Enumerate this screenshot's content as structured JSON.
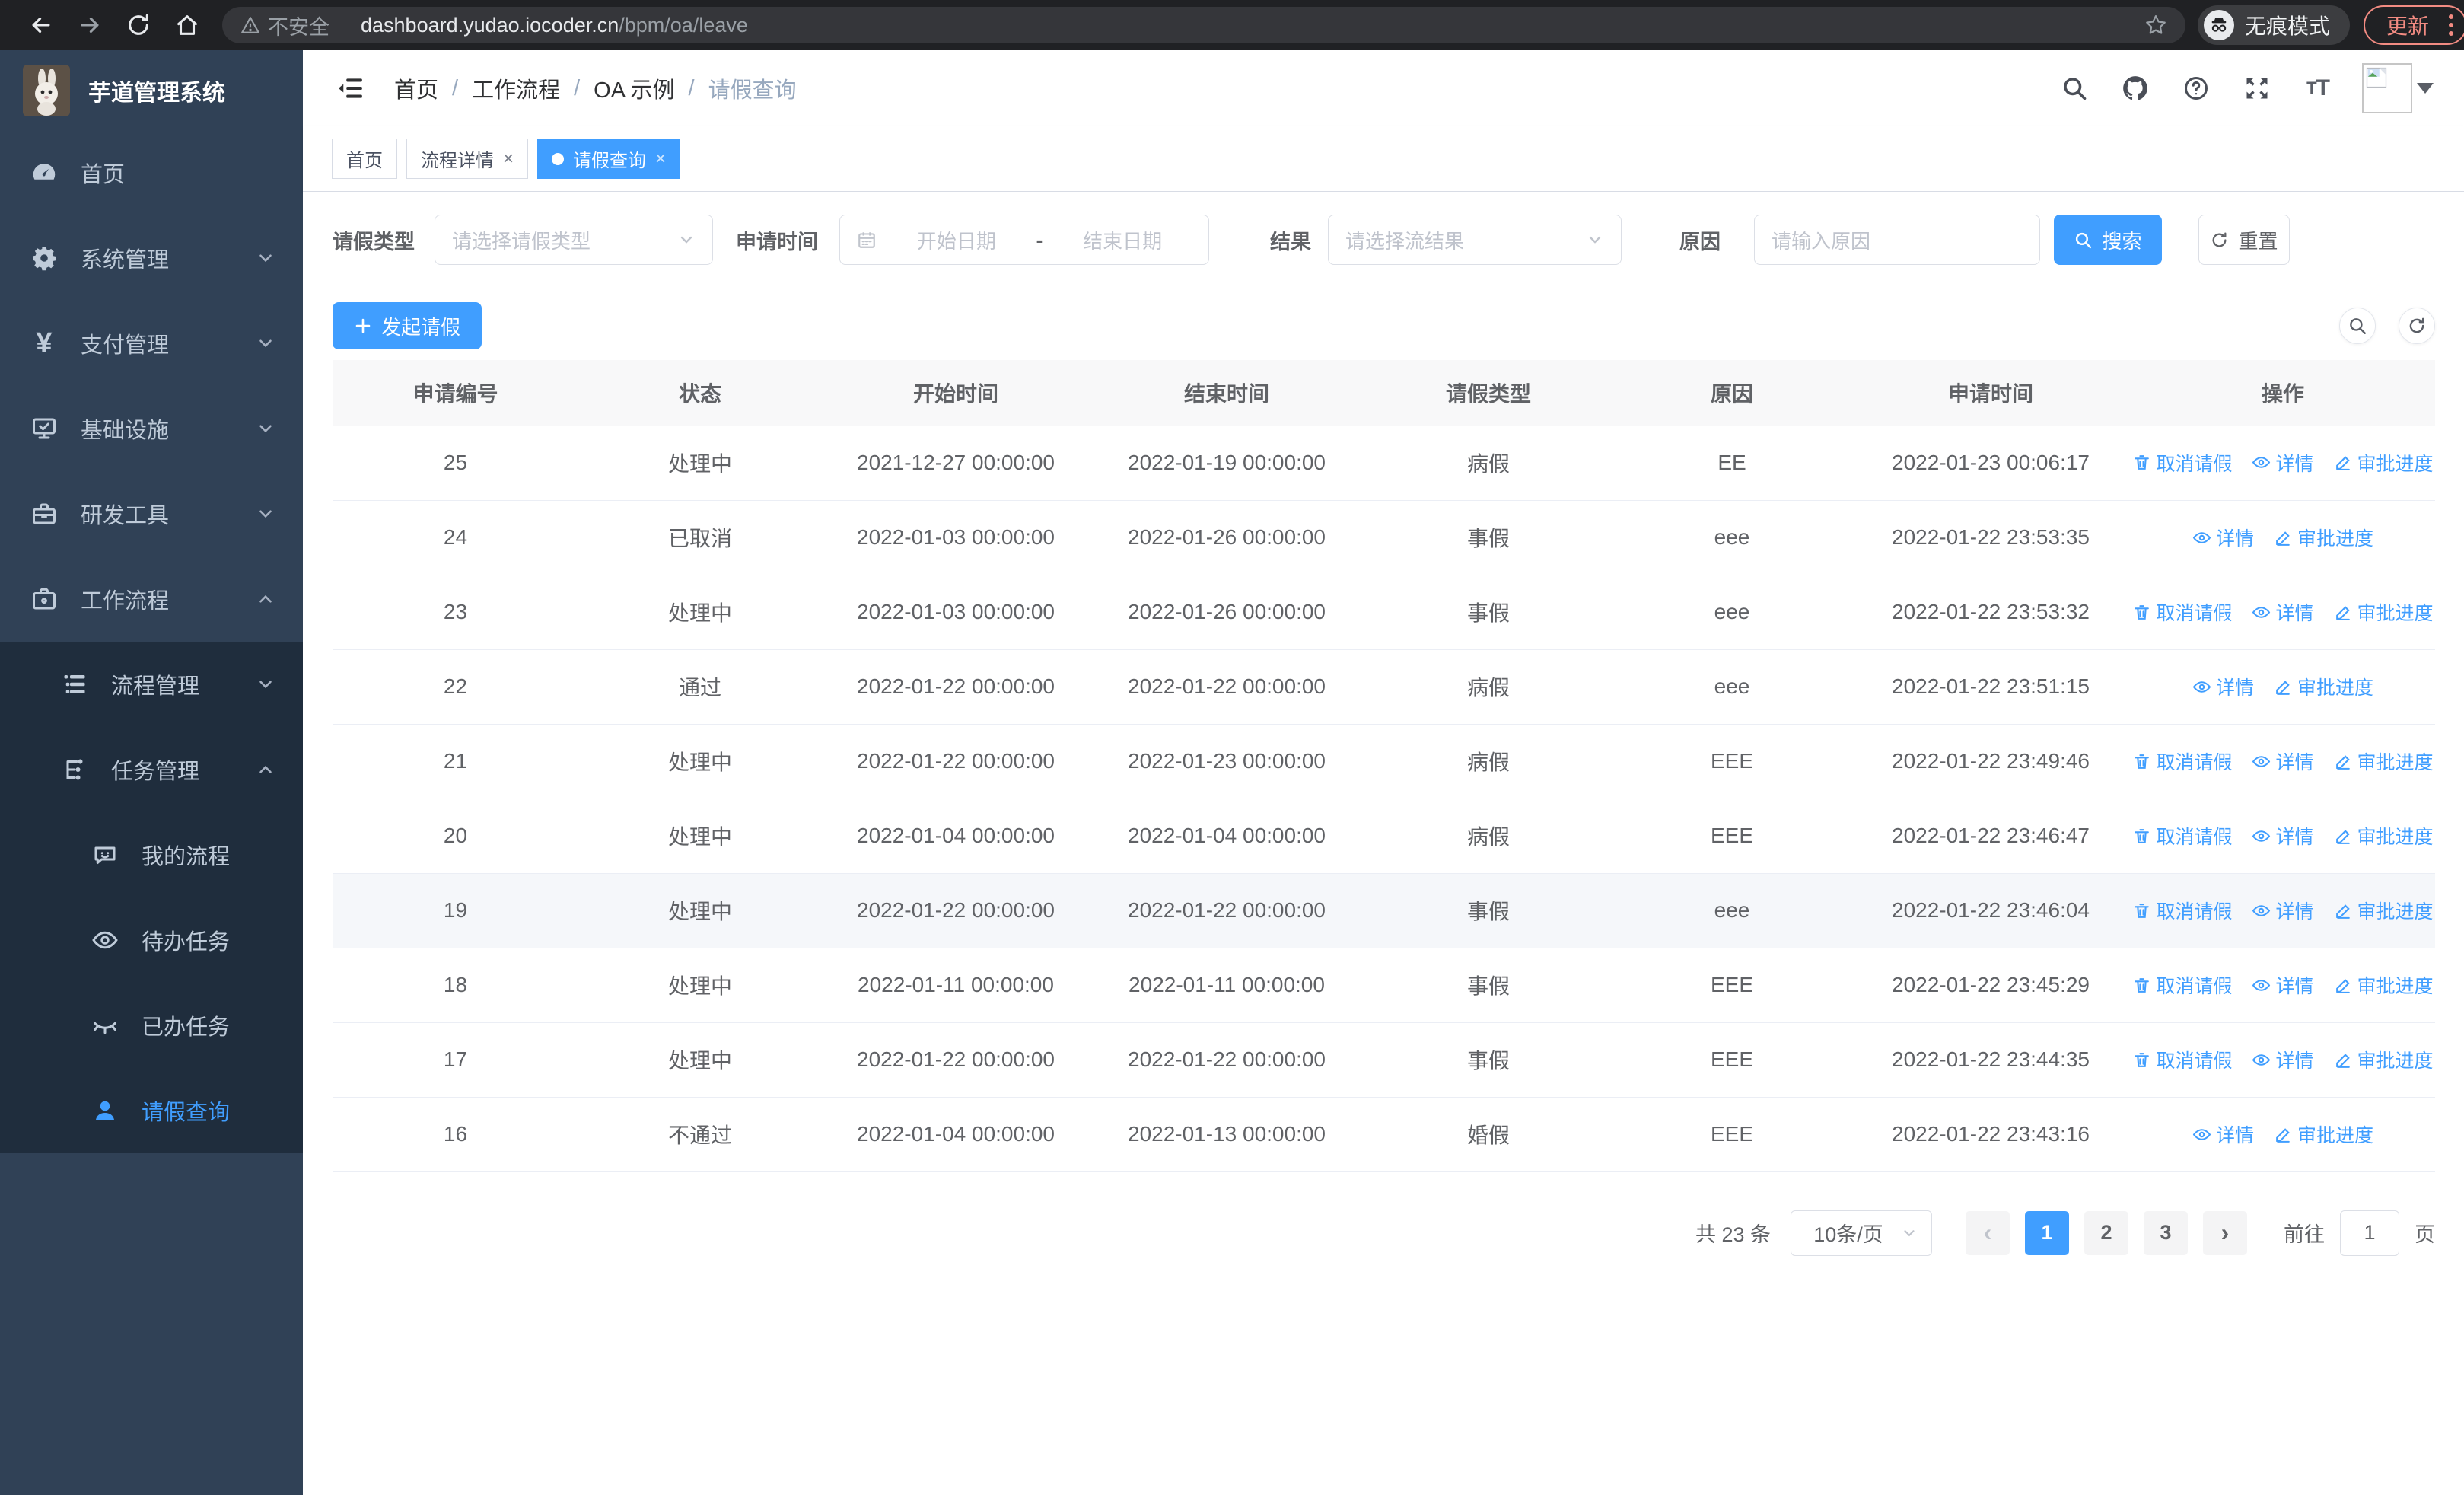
{
  "browser": {
    "security_warning": "不安全",
    "url_host": "dashboard.yudao.iocoder.cn",
    "url_path": "/bpm/oa/leave",
    "incognito_label": "无痕模式",
    "update_label": "更新"
  },
  "sidebar": {
    "app_title": "芋道管理系统",
    "items": [
      {
        "label": "首页"
      },
      {
        "label": "系统管理"
      },
      {
        "label": "支付管理"
      },
      {
        "label": "基础设施"
      },
      {
        "label": "研发工具"
      },
      {
        "label": "工作流程"
      }
    ],
    "submenu": [
      {
        "label": "流程管理"
      },
      {
        "label": "任务管理"
      },
      {
        "label": "我的流程"
      },
      {
        "label": "待办任务"
      },
      {
        "label": "已办任务"
      },
      {
        "label": "请假查询"
      }
    ]
  },
  "header": {
    "breadcrumb": [
      "首页",
      "工作流程",
      "OA 示例",
      "请假查询"
    ]
  },
  "tabs": [
    {
      "label": "首页"
    },
    {
      "label": "流程详情"
    },
    {
      "label": "请假查询"
    }
  ],
  "filters": {
    "type_label": "请假类型",
    "type_placeholder": "请选择请假类型",
    "time_label": "申请时间",
    "start_placeholder": "开始日期",
    "range_separator": "-",
    "end_placeholder": "结束日期",
    "result_label": "结果",
    "result_placeholder": "请选择流结果",
    "reason_label": "原因",
    "reason_placeholder": "请输入原因",
    "search_label": "搜索",
    "reset_label": "重置"
  },
  "toolbar": {
    "create_label": "发起请假"
  },
  "table": {
    "columns": [
      "申请编号",
      "状态",
      "开始时间",
      "结束时间",
      "请假类型",
      "原因",
      "申请时间",
      "操作"
    ],
    "action_labels": {
      "cancel": "取消请假",
      "detail": "详情",
      "progress": "审批进度"
    },
    "rows": [
      {
        "id": "25",
        "status": "处理中",
        "start": "2021-12-27 00:00:00",
        "end": "2022-01-19 00:00:00",
        "type": "病假",
        "reason": "EE",
        "applied": "2022-01-23 00:06:17",
        "cancelable": true,
        "highlighted": false
      },
      {
        "id": "24",
        "status": "已取消",
        "start": "2022-01-03 00:00:00",
        "end": "2022-01-26 00:00:00",
        "type": "事假",
        "reason": "eee",
        "applied": "2022-01-22 23:53:35",
        "cancelable": false,
        "highlighted": false
      },
      {
        "id": "23",
        "status": "处理中",
        "start": "2022-01-03 00:00:00",
        "end": "2022-01-26 00:00:00",
        "type": "事假",
        "reason": "eee",
        "applied": "2022-01-22 23:53:32",
        "cancelable": true,
        "highlighted": false
      },
      {
        "id": "22",
        "status": "通过",
        "start": "2022-01-22 00:00:00",
        "end": "2022-01-22 00:00:00",
        "type": "病假",
        "reason": "eee",
        "applied": "2022-01-22 23:51:15",
        "cancelable": false,
        "highlighted": false
      },
      {
        "id": "21",
        "status": "处理中",
        "start": "2022-01-22 00:00:00",
        "end": "2022-01-23 00:00:00",
        "type": "病假",
        "reason": "EEE",
        "applied": "2022-01-22 23:49:46",
        "cancelable": true,
        "highlighted": false
      },
      {
        "id": "20",
        "status": "处理中",
        "start": "2022-01-04 00:00:00",
        "end": "2022-01-04 00:00:00",
        "type": "病假",
        "reason": "EEE",
        "applied": "2022-01-22 23:46:47",
        "cancelable": true,
        "highlighted": false
      },
      {
        "id": "19",
        "status": "处理中",
        "start": "2022-01-22 00:00:00",
        "end": "2022-01-22 00:00:00",
        "type": "事假",
        "reason": "eee",
        "applied": "2022-01-22 23:46:04",
        "cancelable": true,
        "highlighted": true
      },
      {
        "id": "18",
        "status": "处理中",
        "start": "2022-01-11 00:00:00",
        "end": "2022-01-11 00:00:00",
        "type": "事假",
        "reason": "EEE",
        "applied": "2022-01-22 23:45:29",
        "cancelable": true,
        "highlighted": false
      },
      {
        "id": "17",
        "status": "处理中",
        "start": "2022-01-22 00:00:00",
        "end": "2022-01-22 00:00:00",
        "type": "事假",
        "reason": "EEE",
        "applied": "2022-01-22 23:44:35",
        "cancelable": true,
        "highlighted": false
      },
      {
        "id": "16",
        "status": "不通过",
        "start": "2022-01-04 00:00:00",
        "end": "2022-01-13 00:00:00",
        "type": "婚假",
        "reason": "EEE",
        "applied": "2022-01-22 23:43:16",
        "cancelable": false,
        "highlighted": false
      }
    ]
  },
  "pagination": {
    "total_label": "共 23 条",
    "per_page": "10条/页",
    "pages": [
      "1",
      "2",
      "3"
    ],
    "active_page": "1",
    "goto_label": "前往",
    "goto_value": "1",
    "page_suffix": "页"
  },
  "colors": {
    "primary": "#409eff",
    "sidebar_bg": "#304156",
    "submenu_bg": "#1f2d3d",
    "danger": "#f28b82"
  }
}
